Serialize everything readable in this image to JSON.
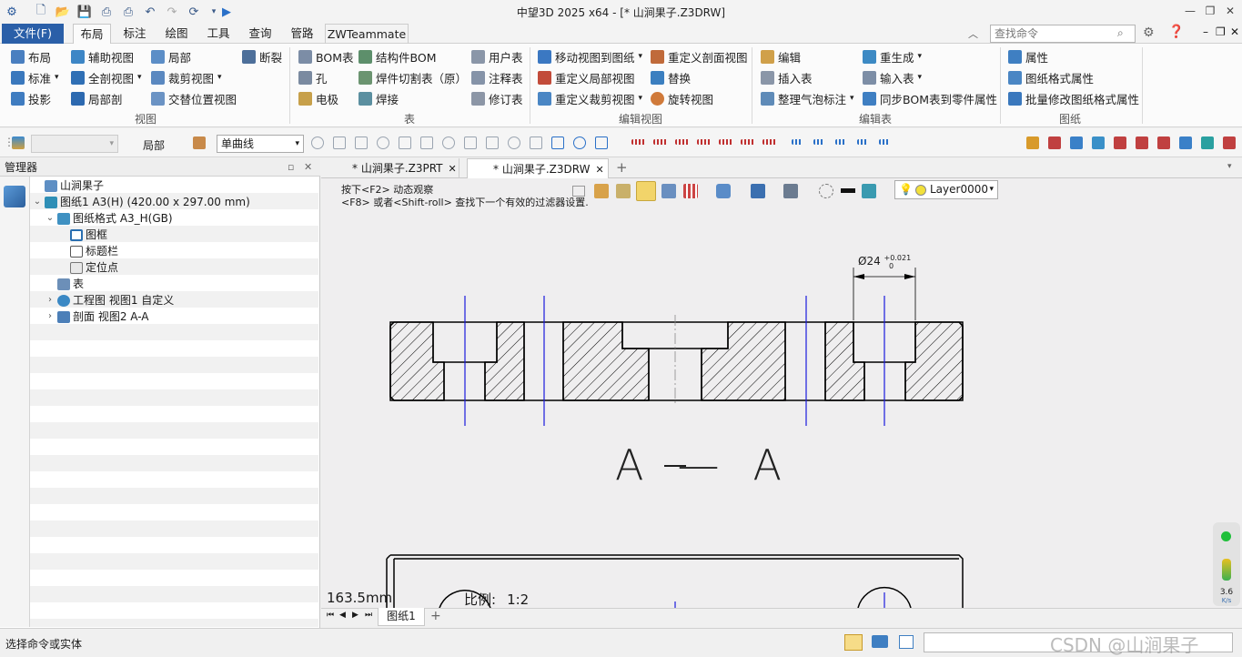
{
  "window": {
    "title": "中望3D 2025 x64 - [* 山涧果子.Z3DRW]"
  },
  "menu_tabs": [
    "文件(F)",
    "布局",
    "标注",
    "绘图",
    "工具",
    "查询",
    "管路",
    "ZWTeammate"
  ],
  "search": {
    "placeholder": "查找命令"
  },
  "ribbon": {
    "view": {
      "label": "视图",
      "items": [
        "布局",
        "辅助视图",
        "局部",
        "断裂",
        "标准",
        "全剖视图",
        "裁剪视图",
        "投影",
        "局部剖",
        "交替位置视图"
      ]
    },
    "table": {
      "label": "表",
      "items": [
        "BOM表",
        "结构件BOM",
        "用户表",
        "孔",
        "焊件切割表（原）",
        "注释表",
        "电极",
        "焊接",
        "修订表"
      ]
    },
    "edit_view": {
      "label": "编辑视图",
      "items": [
        "移动视图到图纸",
        "重定义剖面视图",
        "重定义局部视图",
        "替换",
        "重定义裁剪视图",
        "旋转视图"
      ]
    },
    "edit_table": {
      "label": "编辑表",
      "items": [
        "编辑",
        "重生成",
        "插入表",
        "输入表",
        "整理气泡标注",
        "同步BOM表到零件属性"
      ]
    },
    "sheet": {
      "label": "图纸",
      "items": [
        "属性",
        "图纸格式属性",
        "批量修改图纸格式属性"
      ]
    }
  },
  "toolbar2": {
    "local_label": "局部",
    "line_type": "单曲线"
  },
  "manager": {
    "title": "管理器",
    "tree": [
      "山涧果子",
      "图纸1 A3(H) (420.00 x 297.00 mm)",
      "图纸格式 A3_H(GB)",
      "图框",
      "标题栏",
      "定位点",
      "表",
      "工程图 视图1 自定义",
      "剖面 视图2 A-A"
    ]
  },
  "doc_tabs": [
    "* 山涧果子.Z3PRT",
    "* 山涧果子.Z3DRW"
  ],
  "canvas": {
    "hint1": "按下<F2> 动态观察",
    "hint2": "<F8> 或者<Shift-roll> 查找下一个有效的过滤器设置.",
    "layer": "Layer0000",
    "dim_text": "Ø24",
    "dim_tol": "+0.021",
    "dim_tol_low": "0",
    "section_label": "A—A",
    "coord": "163.5mm",
    "scale_label": "比例:",
    "scale_value": "1:2",
    "speed_value": "3.6",
    "speed_unit": "K/s"
  },
  "sheet_tabs": [
    "图纸1"
  ],
  "status": {
    "prompt": "选择命令或实体",
    "watermark": "CSDN @山涧果子"
  },
  "colors": {
    "accent": "#2a5fa8",
    "centerline": "#1a1adc",
    "hatch": "#000000"
  }
}
